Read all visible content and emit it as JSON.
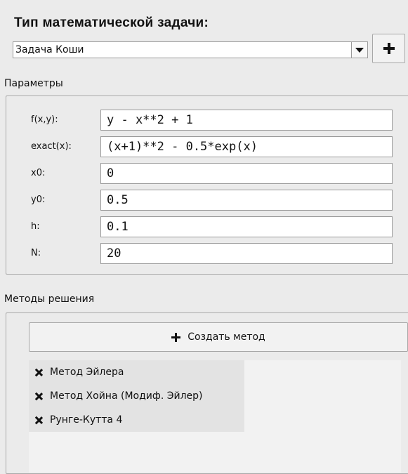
{
  "problem": {
    "heading": "Тип математической задачи:",
    "selected_type": "Задача Коши",
    "add_label": "+"
  },
  "params": {
    "title": "Параметры",
    "rows": [
      {
        "label": "f(x,y):",
        "value": "y - x**2 + 1"
      },
      {
        "label": "exact(x):",
        "value": "(x+1)**2 - 0.5*exp(x)"
      },
      {
        "label": "x0:",
        "value": "0"
      },
      {
        "label": "y0:",
        "value": "0.5"
      },
      {
        "label": "h:",
        "value": "0.1"
      },
      {
        "label": "N:",
        "value": "20"
      }
    ]
  },
  "methods": {
    "title": "Методы решения",
    "create_label": "Создать метод",
    "items": [
      {
        "label": "Метод Эйлера",
        "checked": true
      },
      {
        "label": "Метод Хойна (Модиф. Эйлер)",
        "checked": true
      },
      {
        "label": "Рунге-Кутта 4",
        "checked": true
      }
    ]
  },
  "icons": {
    "combo_arrow": "chevron-down-icon",
    "add": "plus-icon",
    "check": "checkbox-checked-icon"
  }
}
